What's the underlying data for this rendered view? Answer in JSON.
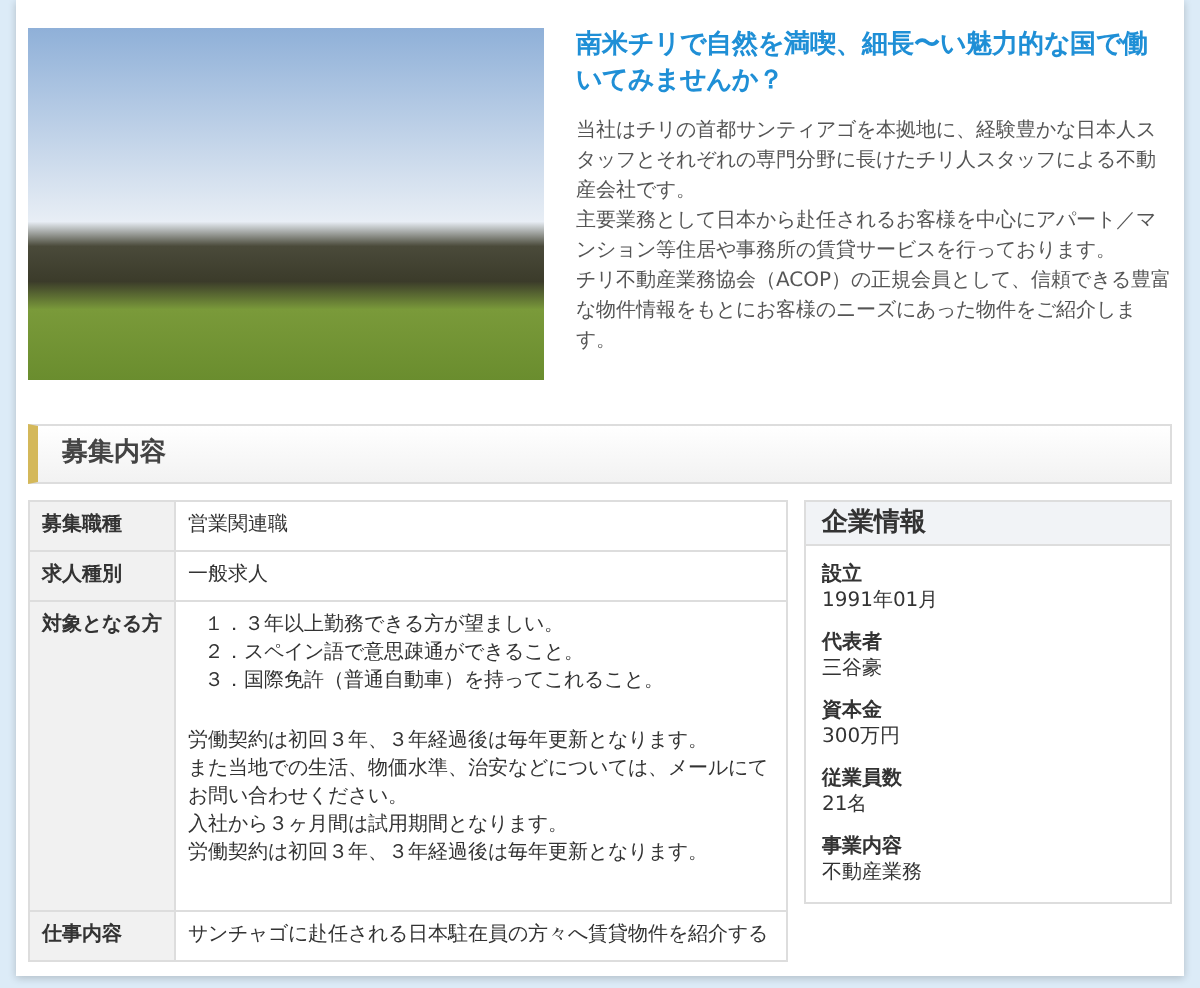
{
  "intro": {
    "heading": "南米チリで自然を満喫、細長〜い魅力的な国で働いてみませんか？",
    "paragraphs": [
      "当社はチリの首都サンティアゴを本拠地に、経験豊かな日本人スタッフとそれぞれの専門分野に長けたチリ人スタッフによる不動産会社です。",
      "主要業務として日本から赴任されるお客様を中心にアパート／マンション等住居や事務所の賃貸サービスを行っております。",
      "チリ不動産業務協会（ACOP）の正規会員として、信頼できる豊富な物件情報をもとにお客様のニーズにあった物件をご紹介します。"
    ]
  },
  "section": {
    "title": "募集内容"
  },
  "job_table": {
    "rows": [
      {
        "kind": "text",
        "label": "募集職種",
        "lines": [
          "営業関連職"
        ]
      },
      {
        "kind": "text",
        "label": "求人種別",
        "lines": [
          "一般求人"
        ]
      },
      {
        "kind": "list",
        "label": "対象となる方",
        "items": [
          "１．３年以上勤務できる方が望ましい。",
          "２．スペイン語で意思疎通ができること。",
          "３．国際免許（普通自動車）を持ってこれること。"
        ],
        "notes": [
          "労働契約は初回３年、３年経過後は毎年更新となります。",
          "また当地での生活、物価水準、治安などについては、メールにてお問い合わせください。",
          "入社から３ヶ月間は試用期間となります。",
          "労働契約は初回３年、３年経過後は毎年更新となります。"
        ]
      },
      {
        "kind": "text",
        "label": "仕事内容",
        "lines": [
          "サンチャゴに赴任される日本駐在員の方々へ賃貸物件を紹介する"
        ]
      }
    ]
  },
  "company": {
    "title": "企業情報",
    "items": [
      {
        "label": "設立",
        "value": "1991年01月"
      },
      {
        "label": "代表者",
        "value": "三谷豪"
      },
      {
        "label": "資本金",
        "value": "300万円"
      },
      {
        "label": "従業員数",
        "value": "21名"
      },
      {
        "label": "事業内容",
        "value": "不動産業務"
      }
    ]
  }
}
